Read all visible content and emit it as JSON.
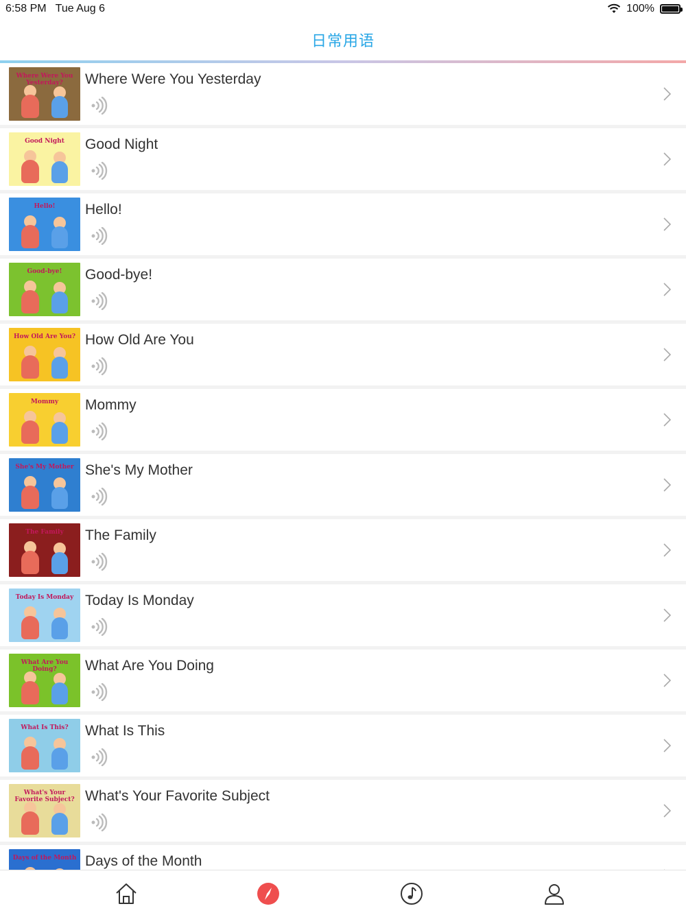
{
  "status_bar": {
    "time": "6:58 PM",
    "date": "Tue Aug 6",
    "battery": "100%",
    "wifi_icon": "wifi-icon",
    "battery_icon": "battery-icon"
  },
  "nav": {
    "title": "日常用语"
  },
  "lessons": [
    {
      "title": "Where Were You Yesterday",
      "thumb_caption": "Where Were You Yesterday?",
      "thumb_bg": "#8b6a3e"
    },
    {
      "title": "Good Night",
      "thumb_caption": "Good Night",
      "thumb_bg": "#faf3a2"
    },
    {
      "title": "Hello!",
      "thumb_caption": "Hello!",
      "thumb_bg": "#3a8fe0"
    },
    {
      "title": "Good-bye!",
      "thumb_caption": "Good-bye!",
      "thumb_bg": "#7cc22f"
    },
    {
      "title": "How Old Are You",
      "thumb_caption": "How Old Are You?",
      "thumb_bg": "#f6c324"
    },
    {
      "title": "Mommy",
      "thumb_caption": "Mommy",
      "thumb_bg": "#f8cf30"
    },
    {
      "title": "She's My Mother",
      "thumb_caption": "She's My Mother",
      "thumb_bg": "#2f7fd0"
    },
    {
      "title": "The Family",
      "thumb_caption": "The Family",
      "thumb_bg": "#8b1e1e"
    },
    {
      "title": "Today Is Monday",
      "thumb_caption": "Today Is Monday",
      "thumb_bg": "#9fd3f0"
    },
    {
      "title": "What Are You Doing",
      "thumb_caption": "What Are You Doing?",
      "thumb_bg": "#7bc22a"
    },
    {
      "title": "What Is This",
      "thumb_caption": "What Is This?",
      "thumb_bg": "#8fcde8"
    },
    {
      "title": "What's Your Favorite Subject",
      "thumb_caption": "What's Your Favorite Subject?",
      "thumb_bg": "#e8dc9a"
    },
    {
      "title": "Days of the Month",
      "thumb_caption": "Days of the Month",
      "thumb_bg": "#2a6fd0"
    }
  ],
  "tabs": [
    {
      "icon": "home-icon",
      "active": false
    },
    {
      "icon": "compass-icon",
      "active": true
    },
    {
      "icon": "music-note-icon",
      "active": false
    },
    {
      "icon": "profile-icon",
      "active": false
    }
  ],
  "colors": {
    "accent": "#2aa7e6",
    "active_tab": "#ef4e4e",
    "icon_gray": "#bbbbbb",
    "separator": "#f2f2f2"
  }
}
